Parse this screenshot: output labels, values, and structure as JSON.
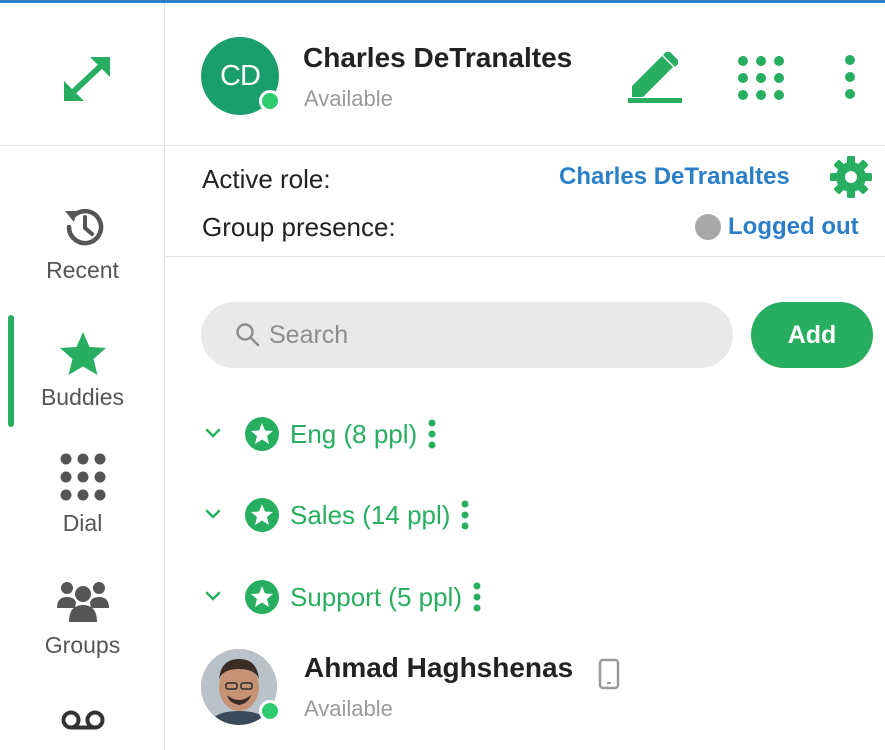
{
  "header": {
    "avatar_initials": "CD",
    "user_name": "Charles DeTranaltes",
    "status": "Available"
  },
  "roles": {
    "active_role_label": "Active role:",
    "active_role_value": "Charles DeTranaltes",
    "group_presence_label": "Group presence:",
    "group_presence_value": "Logged out"
  },
  "nav": {
    "items": [
      {
        "label": "Recent",
        "icon": "history-icon",
        "active": false
      },
      {
        "label": "Buddies",
        "icon": "star-icon",
        "active": true
      },
      {
        "label": "Dial",
        "icon": "dialpad-icon",
        "active": false
      },
      {
        "label": "Groups",
        "icon": "people-icon",
        "active": false
      },
      {
        "label": "",
        "icon": "voicemail-icon",
        "active": false
      }
    ]
  },
  "search": {
    "placeholder": "Search",
    "add_label": "Add"
  },
  "groups": [
    {
      "label": "Eng (8 ppl)"
    },
    {
      "label": "Sales (14 ppl)"
    },
    {
      "label": "Support (5 ppl)"
    }
  ],
  "contacts": [
    {
      "name": "Ahmad Haghshenas",
      "status": "Available"
    }
  ],
  "colors": {
    "accent": "#27ae60",
    "link": "#2b7fc8",
    "avatar": "#1b9e6e",
    "presence_available": "#2ecc71",
    "presence_offline": "#a9a9a9"
  }
}
